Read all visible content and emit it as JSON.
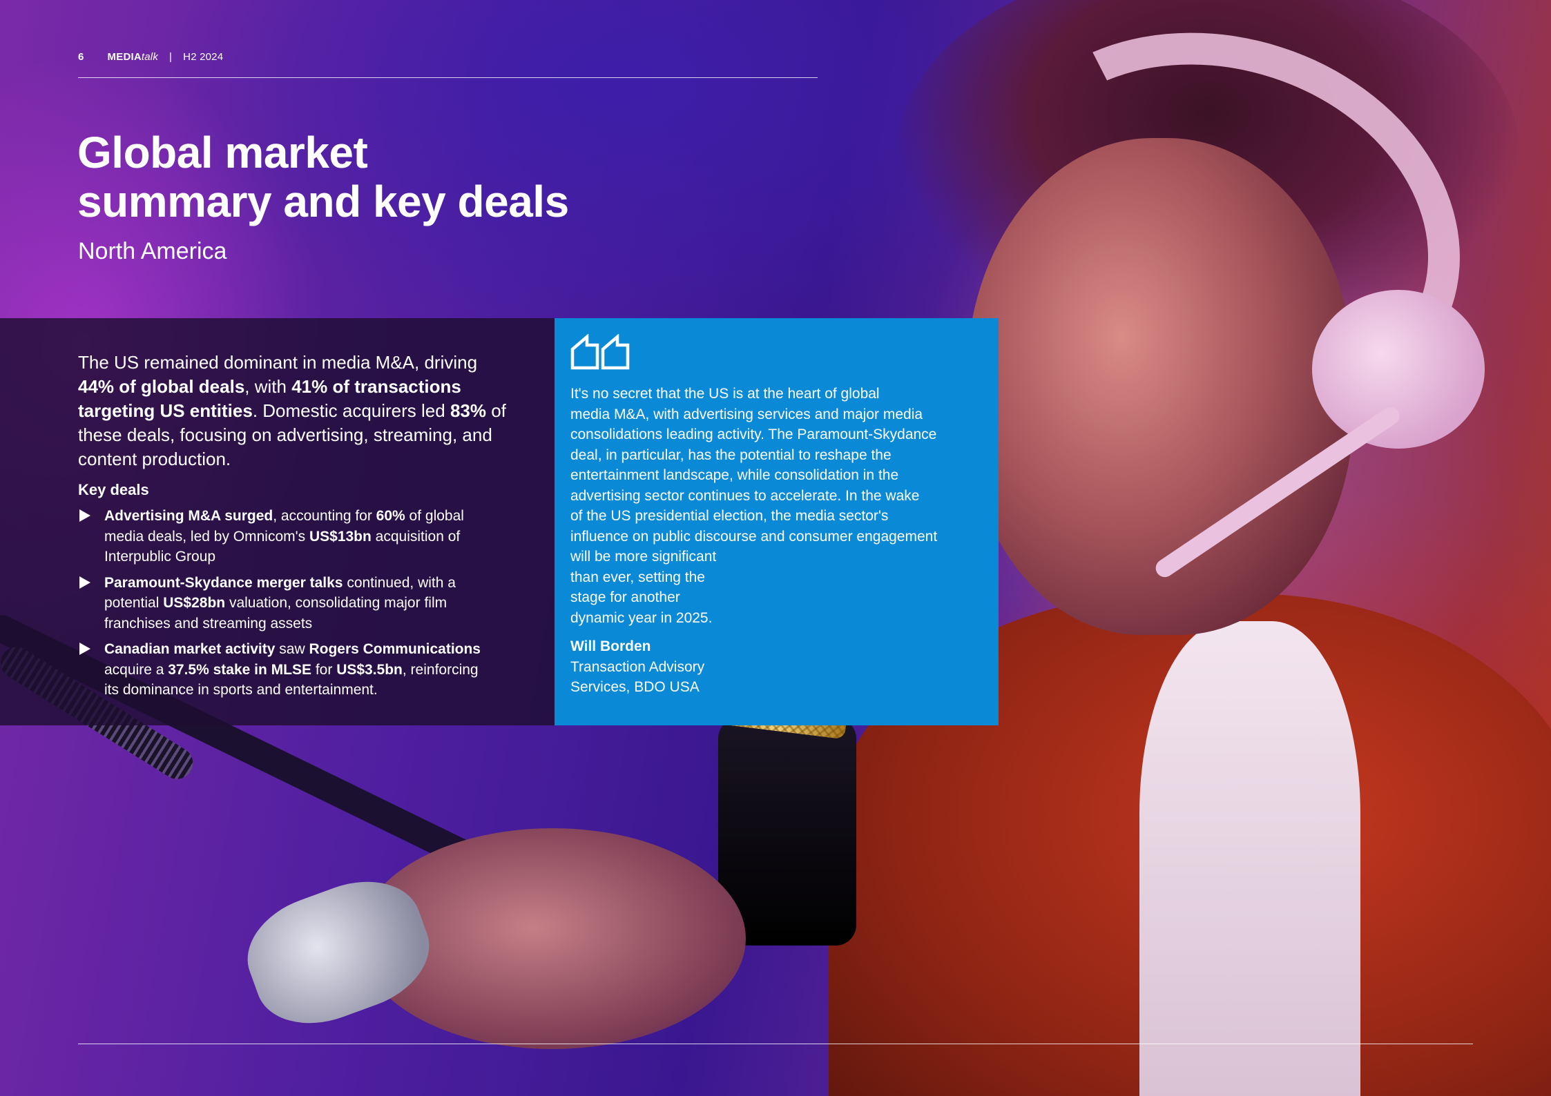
{
  "header": {
    "page_number": "6",
    "brand_bold": "MEDIA",
    "brand_italic": "talk",
    "separator": "|",
    "period": "H2 2024"
  },
  "title": {
    "line1": "Global market",
    "line2": "summary and key deals",
    "subtitle": "North America"
  },
  "intro": {
    "p1": "The US remained dominant in media M&A, driving ",
    "b1": "44% of global deals",
    "p2": ", with ",
    "b2": "41% of transactions targeting US entities",
    "p3": ". Domestic acquirers led ",
    "b3": "83%",
    "p4": " of these deals, focusing on advertising, streaming, and content production."
  },
  "key_deals": {
    "heading": "Key deals",
    "items": [
      {
        "b1": "Advertising M&A surged",
        "t1": ", accounting for ",
        "b2": "60%",
        "t2": " of global media deals, led by Omnicom's ",
        "b3": "US$13bn",
        "t3": " acquisition of Interpublic Group"
      },
      {
        "b1": "Paramount-Skydance merger talks",
        "t1": " continued, with a potential ",
        "b2": "US$28bn",
        "t2": " valuation, consolidating major film franchises and streaming assets"
      },
      {
        "b1": "Canadian market activity",
        "t1": " saw ",
        "b2": "Rogers Communications",
        "t2": " acquire a ",
        "b3": "37.5% stake in MLSE",
        "t3": " for ",
        "b4": "US$3.5bn",
        "t4": ", reinforcing its dominance in sports and entertainment."
      }
    ]
  },
  "quote": {
    "text": "It's no secret that the US is at the heart of global\nmedia M&A, with advertising services and major media\nconsolidations leading activity. The Paramount-Skydance\ndeal, in particular, has the potential to reshape the\nentertainment landscape, while consolidation in the\nadvertising sector continues to accelerate. In the wake\nof the US presidential election, the media sector's\ninfluence on public discourse and consumer engagement\nwill be more significant\nthan ever, setting the\nstage for another\ndynamic year in 2025.",
    "author_name": "Will Borden",
    "author_title_line1": "Transaction Advisory",
    "author_title_line2": "Services, BDO USA"
  },
  "colors": {
    "quote_panel": "#0a8ad6",
    "text": "#ffffff"
  }
}
